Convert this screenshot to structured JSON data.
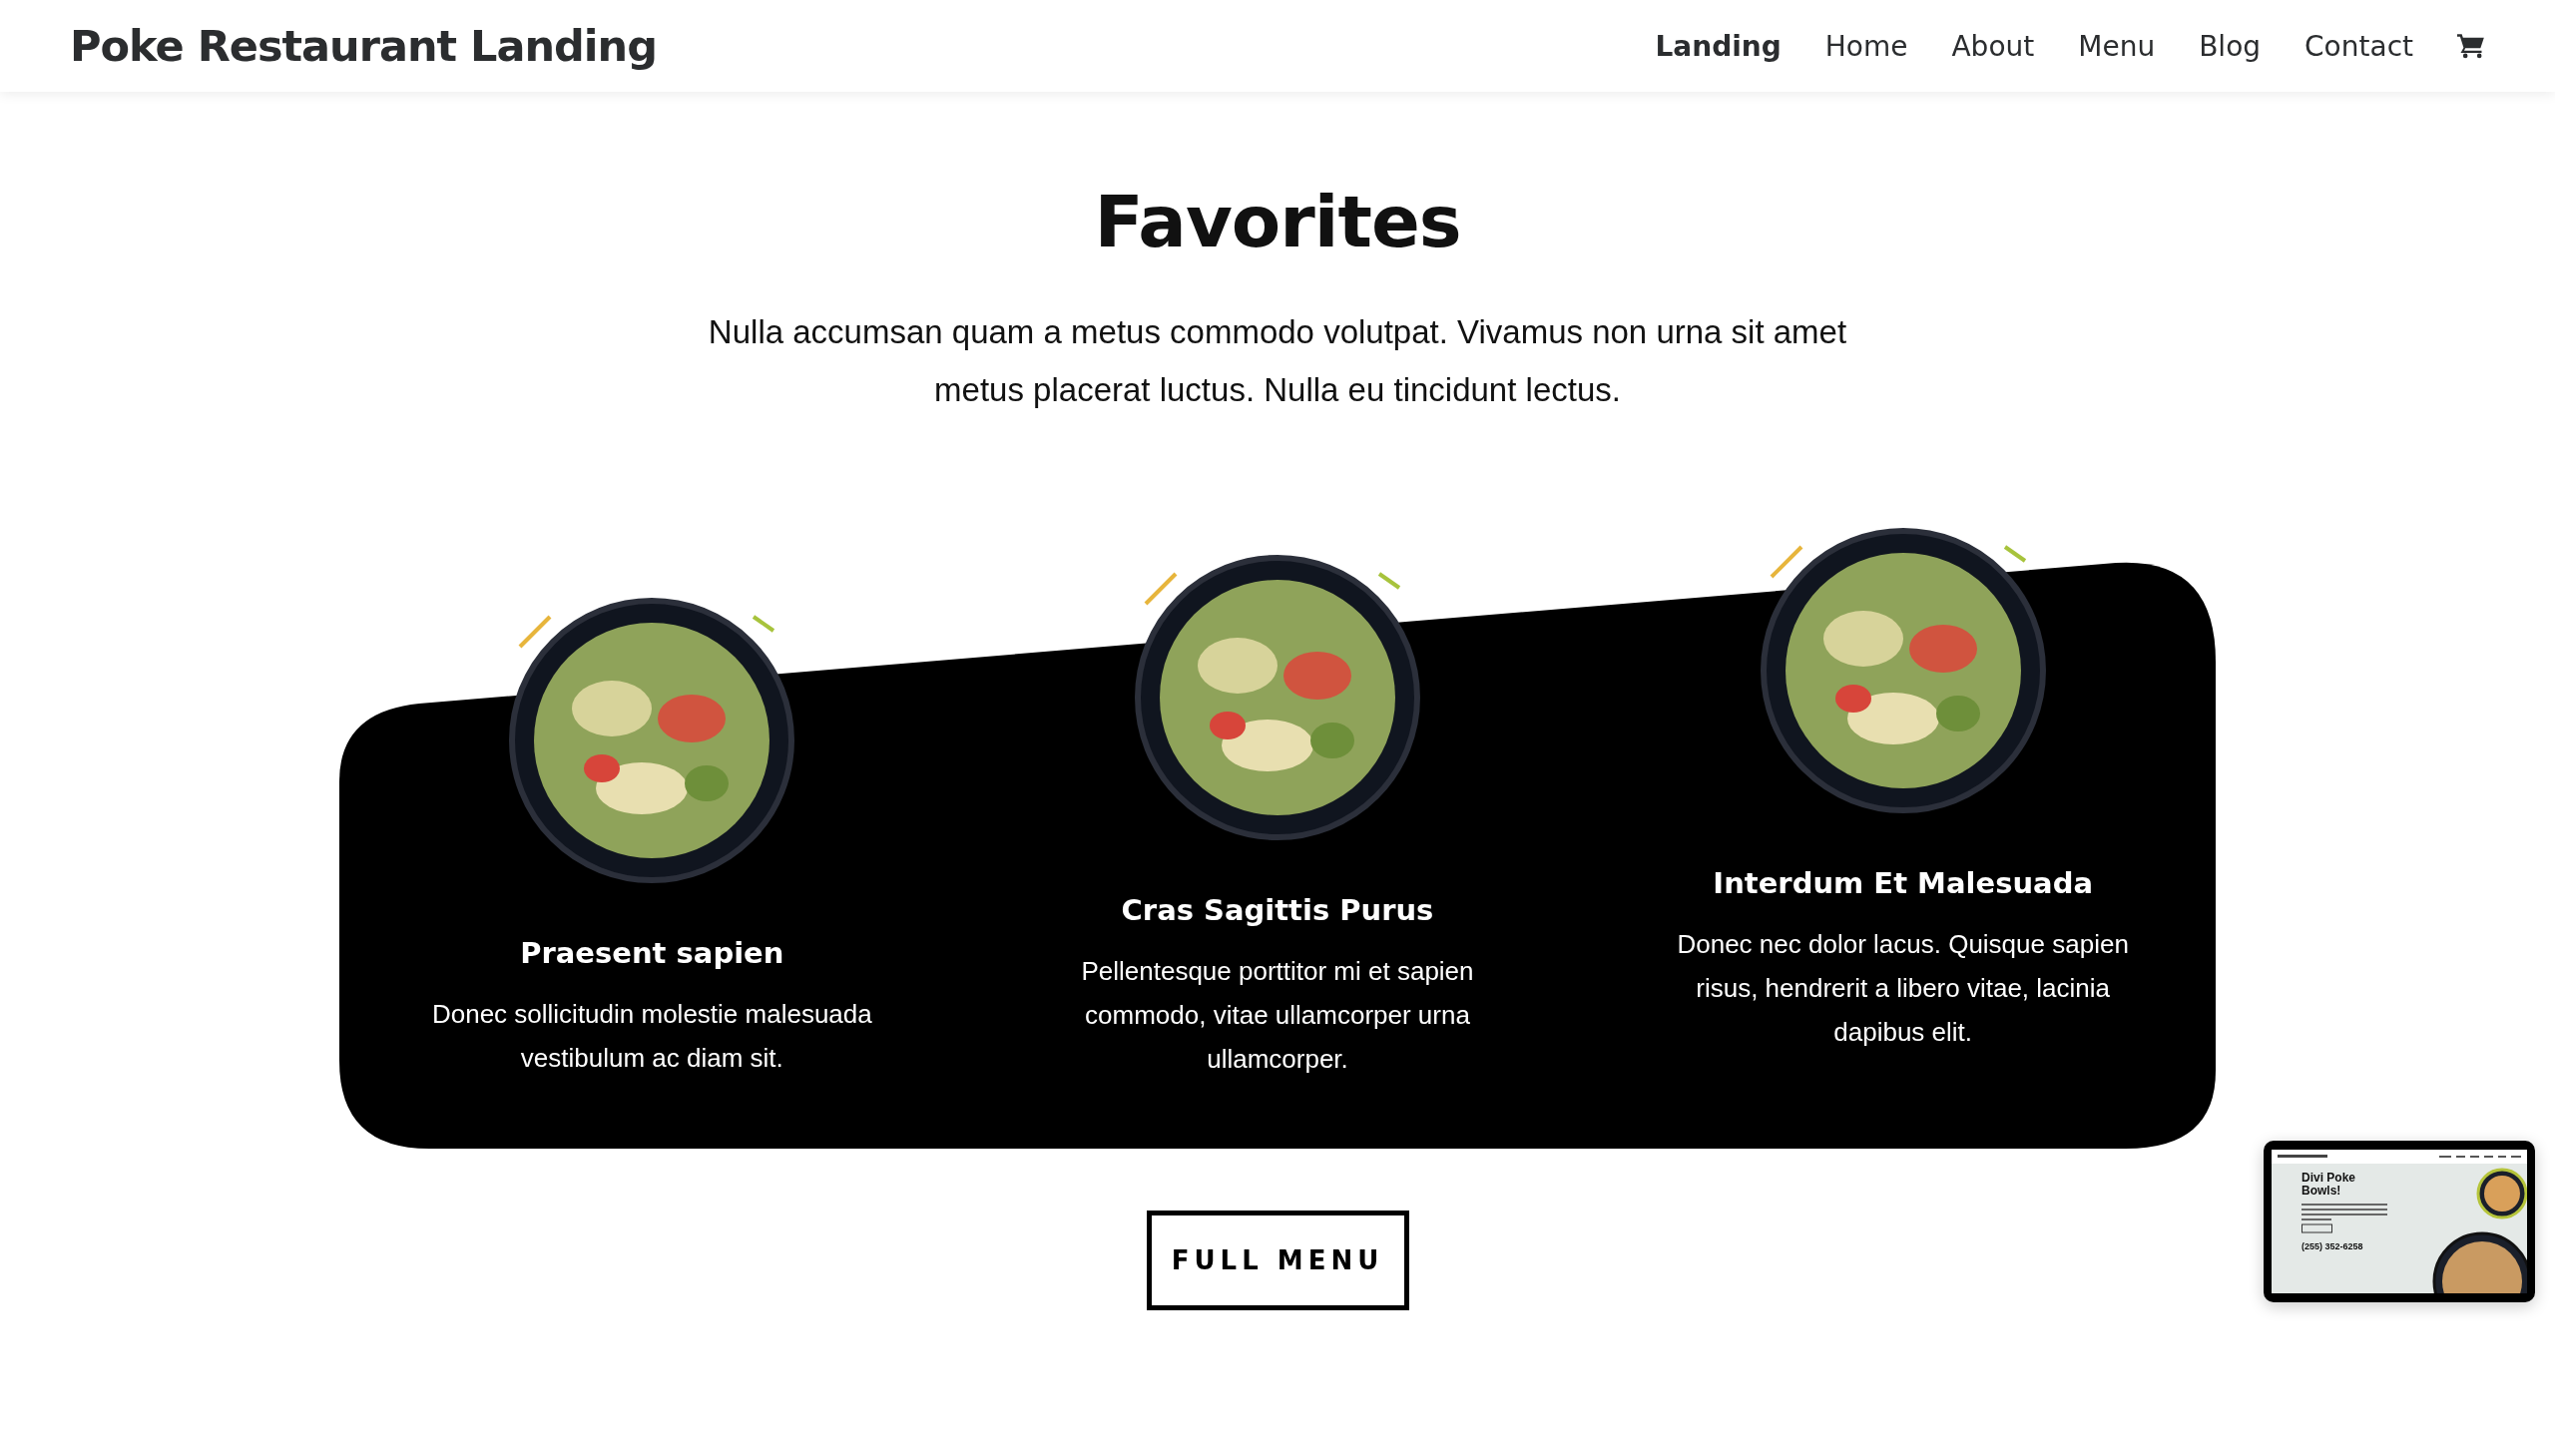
{
  "header": {
    "site_title": "Poke Restaurant Landing",
    "nav": [
      {
        "label": "Landing",
        "selected": true
      },
      {
        "label": "Home",
        "selected": false
      },
      {
        "label": "About",
        "selected": false
      },
      {
        "label": "Menu",
        "selected": false
      },
      {
        "label": "Blog",
        "selected": false
      },
      {
        "label": "Contact",
        "selected": false
      }
    ]
  },
  "section": {
    "title": "Favorites",
    "intro": "Nulla accumsan quam a metus commodo volutpat. Vivamus non urna sit amet metus placerat luctus. Nulla eu tincidunt lectus."
  },
  "items": [
    {
      "name": "Praesent sapien",
      "description": "Donec sollicitudin molestie malesuada vestibulum ac diam sit."
    },
    {
      "name": "Cras Sagittis Purus",
      "description": "Pellentesque porttitor mi et sapien commodo, vitae ullamcorper urna ullamcorper."
    },
    {
      "name": "Interdum Et Malesuada",
      "description": "Donec nec dolor lacus. Quisque sapien risus, hendrerit a libero vitae, lacinia dapibus elit."
    }
  ],
  "button": "FULL MENU",
  "preview": {
    "heading": "Divi Poke Bowls!",
    "phone": "(255) 352-6258"
  }
}
